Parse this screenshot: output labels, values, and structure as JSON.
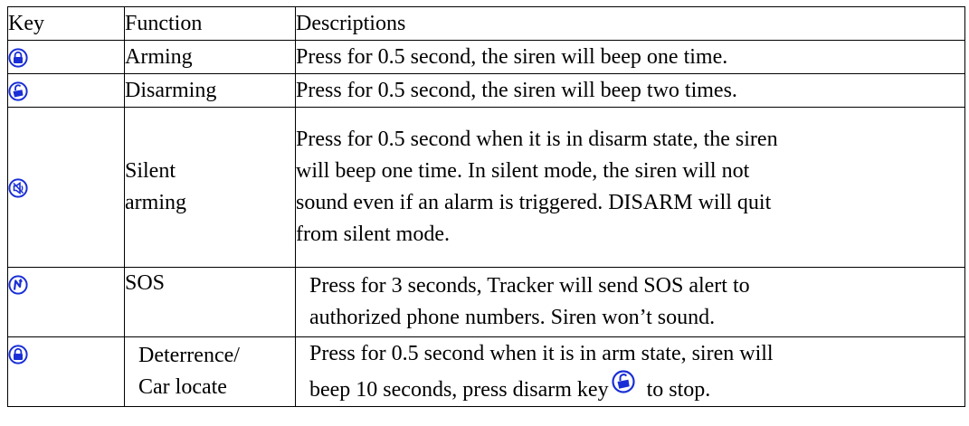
{
  "table": {
    "headers": {
      "key": "Key",
      "function": "Function",
      "description": "Descriptions"
    },
    "rows": [
      {
        "icon": "lock-icon",
        "function_lines": [
          "Arming"
        ],
        "description_lines": [
          "Press for 0.5 second, the siren will beep one time."
        ]
      },
      {
        "icon": "unlock-icon",
        "function_lines": [
          "Disarming"
        ],
        "description_lines": [
          "Press for 0.5 second, the siren will beep two times."
        ]
      },
      {
        "icon": "silent-speaker-icon",
        "function_lines": [
          "Silent",
          "arming"
        ],
        "description_lines": [
          "Press for 0.5 second when it is in disarm state, the siren",
          "will beep one time. In silent mode, the siren will not",
          "sound even if an alarm is triggered. DISARM will quit",
          "from silent mode."
        ]
      },
      {
        "icon": "sos-lightning-icon",
        "function_lines": [
          "SOS"
        ],
        "description_lines": [
          "Press for 3 seconds, Tracker will send SOS alert to",
          "authorized phone numbers. Siren won’t sound."
        ]
      },
      {
        "icon": "lock-icon",
        "function_lines": [
          "Deterrence/",
          "Car locate"
        ],
        "description_lines": [
          "Press for 0.5 second when it is in arm state, siren will",
          "beep 10 seconds, press disarm key",
          " to stop."
        ],
        "inline_icon": "unlock-icon"
      }
    ]
  },
  "colors": {
    "icon_blue": "#1a2fd6",
    "border": "#000000",
    "text": "#000000"
  }
}
